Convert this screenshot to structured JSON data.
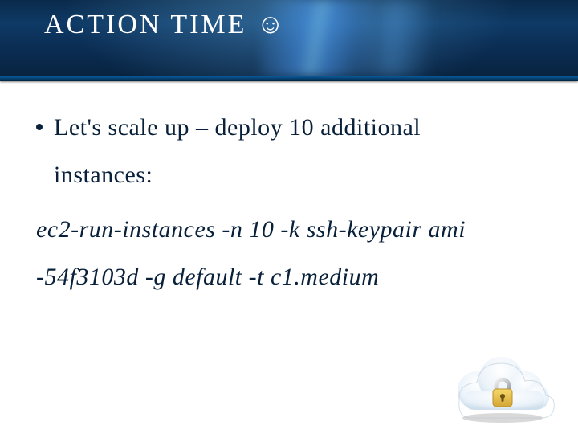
{
  "title": {
    "text": "ACTION TIME",
    "emoji": "☺"
  },
  "bullet": {
    "lead": "Let's scale up – deploy 10 additional",
    "cont": "instances:"
  },
  "command": {
    "line1": "ec2-run-instances -n 10 -k ssh-keypair ami",
    "line2": "-54f3103d -g default -t c1.medium"
  },
  "icon": {
    "name": "cloud-lock"
  },
  "colors": {
    "text": "#08203a",
    "header_bg": "#0b2e55",
    "white": "#ffffff"
  }
}
